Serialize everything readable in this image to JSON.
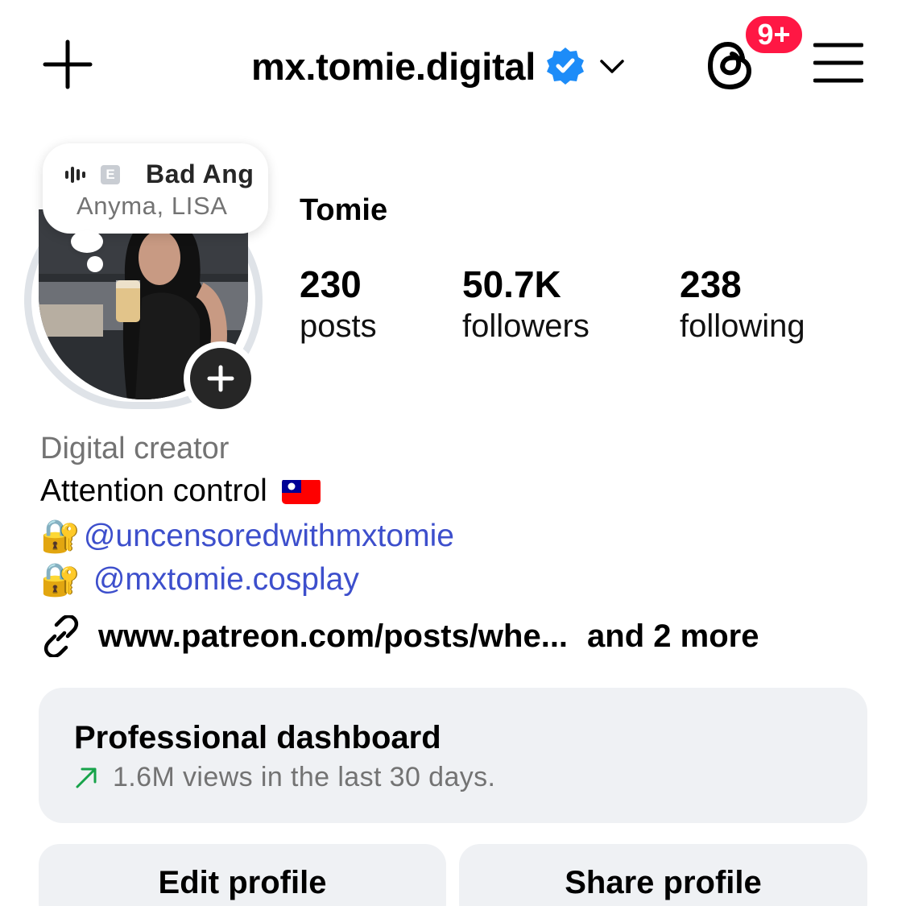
{
  "header": {
    "username": "mx.tomie.digital",
    "verified": true,
    "notification_badge": "9+",
    "icons": [
      "plus-icon",
      "verified-badge-icon",
      "chevron-down-icon",
      "threads-icon",
      "hamburger-menu-icon"
    ]
  },
  "note": {
    "title": "Bad Ang",
    "artist": "Anyma, LISA",
    "explicit_label": "E"
  },
  "profile": {
    "display_name": "Tomie",
    "stats": [
      {
        "value": "230",
        "label": "posts"
      },
      {
        "value": "50.7K",
        "label": "followers"
      },
      {
        "value": "238",
        "label": "following"
      }
    ]
  },
  "bio": {
    "category": "Digital creator",
    "line1": "Attention control",
    "mention1": "@uncensoredwithmxtomie",
    "mention2": "@mxtomie.cosplay",
    "lock_emoji": "🔐",
    "link": "www.patreon.com/posts/whe...",
    "link_more": "and 2 more"
  },
  "dashboard": {
    "title": "Professional dashboard",
    "subtitle": "1.6M views in the last 30 days."
  },
  "buttons": {
    "edit": "Edit profile",
    "share": "Share profile"
  },
  "colors": {
    "verified_blue": "#1d8cf8",
    "badge_red": "#ff1744",
    "link_blue": "#3d4fcc",
    "trend_green": "#17a34a",
    "card_bg": "#eff1f4"
  }
}
